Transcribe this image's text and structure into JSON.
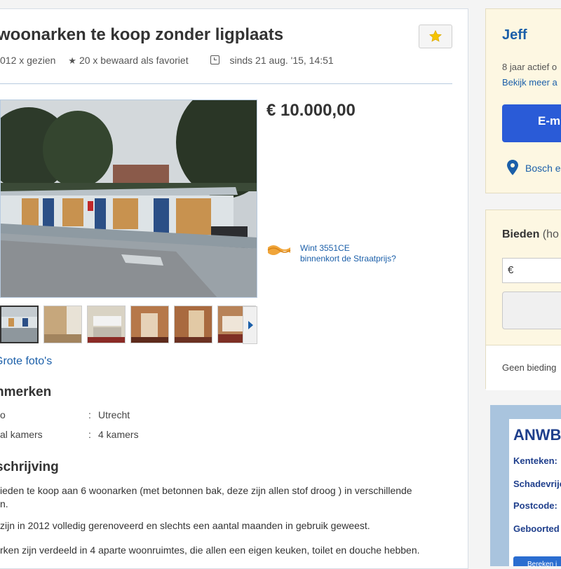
{
  "listing": {
    "title": "woonarken te koop zonder ligplaats",
    "views": "012 x gezien",
    "favorites": "20 x bewaard als favoriet",
    "since": "sinds 21 aug. '15, 14:51",
    "price": "€ 10.000,00",
    "promo_line1": "Wint 3551CE",
    "promo_line2": "binnenkort de Straatprijs?",
    "big_photos_link": "Grote foto's"
  },
  "attributes": {
    "heading": "nmerken",
    "rows": [
      {
        "label": "o",
        "sep": ":",
        "value": "Utrecht"
      },
      {
        "label": "al kamers",
        "sep": ":",
        "value": "4 kamers"
      }
    ]
  },
  "description": {
    "heading": "schrijving",
    "lines": [
      "ieden te koop aan 6 woonarken (met betonnen bak, deze zijn allen stof droog ) in verschillende",
      "n.",
      "zijn in 2012 volledig gerenoveerd en slechts een aantal maanden in gebruik geweest.",
      "rken zijn verdeeld in 4 aparte woonruimtes, die allen een eigen keuken, toilet en douche hebben."
    ]
  },
  "seller": {
    "name": "Jeff",
    "active": "8 jaar actief o",
    "more_link": "Bekijk meer a",
    "email_button": "E-m",
    "location": "Bosch e"
  },
  "bid": {
    "title": "Bieden",
    "title_sub": "(ho",
    "currency": "€",
    "no_bids": "Geen bieding"
  },
  "ad": {
    "brand": "ANWB",
    "fields": [
      "Kenteken:",
      "Schadevrije",
      "Postcode:",
      "Geboorted"
    ],
    "button": "Bereken j"
  },
  "colors": {
    "link": "#1b5fa9",
    "primary_button": "#2a5bd7",
    "sidebar_bg": "#fdf7e2",
    "star": "#f5c400"
  }
}
